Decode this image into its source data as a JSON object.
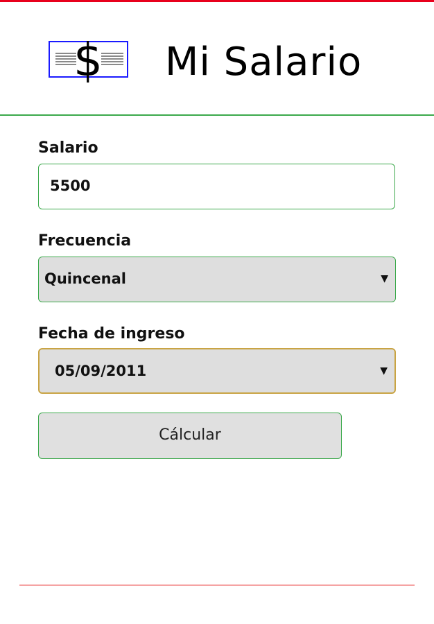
{
  "header": {
    "title": "Mi Salario",
    "logo_icon": "dollar-document-icon"
  },
  "form": {
    "salary": {
      "label": "Salario",
      "value": "5500"
    },
    "frequency": {
      "label": "Frecuencia",
      "selected": "Quincenal"
    },
    "start_date": {
      "label": "Fecha de ingreso",
      "value": "05/09/2011"
    },
    "calculate_label": "Cálcular"
  },
  "colors": {
    "top_border": "#e8001c",
    "accent_green": "#3aa84a",
    "focus_border": "#c9a444",
    "footer_line": "#f5a3a3",
    "logo_blue": "#1a1aff"
  }
}
